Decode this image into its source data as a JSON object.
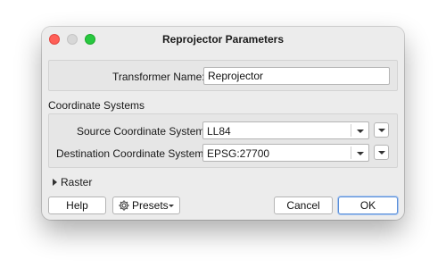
{
  "window": {
    "title": "Reprojector Parameters"
  },
  "transformer": {
    "name_label": "Transformer Name:",
    "name_value": "Reprojector"
  },
  "coordinate_systems": {
    "section_label": "Coordinate Systems",
    "source_label": "Source Coordinate System:",
    "source_value": "LL84",
    "destination_label": "Destination Coordinate System:",
    "destination_value": "EPSG:27700"
  },
  "raster": {
    "label": "Raster"
  },
  "buttons": {
    "help": "Help",
    "presets": "Presets",
    "cancel": "Cancel",
    "ok": "OK"
  },
  "icons": {
    "gear": "gear-icon",
    "dropdown": "chevron-down-icon",
    "expand": "chevron-right-icon"
  }
}
